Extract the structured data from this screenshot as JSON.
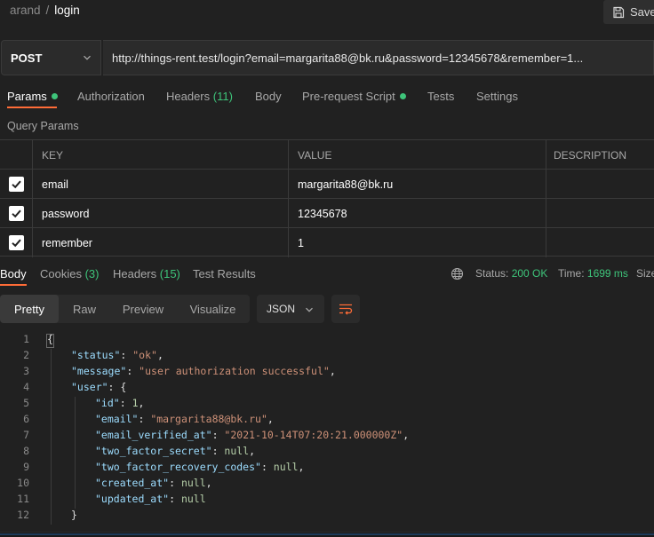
{
  "breadcrumb": {
    "parent": "arand",
    "separator": "/",
    "current": "login"
  },
  "save_label": "Save",
  "request": {
    "method": "POST",
    "url": "http://things-rent.test/login?email=margarita88@bk.ru&password=12345678&remember=1..."
  },
  "request_tabs": [
    {
      "label": "Params",
      "count": "",
      "dot": true,
      "active": true
    },
    {
      "label": "Authorization",
      "count": "",
      "dot": false
    },
    {
      "label": "Headers",
      "count": "(11)",
      "dot": false
    },
    {
      "label": "Body",
      "count": "",
      "dot": false
    },
    {
      "label": "Pre-request Script",
      "count": "",
      "dot": true
    },
    {
      "label": "Tests",
      "count": "",
      "dot": false
    },
    {
      "label": "Settings",
      "count": "",
      "dot": false
    }
  ],
  "query_params_title": "Query Params",
  "params_table": {
    "headers": {
      "key": "KEY",
      "value": "VALUE",
      "description": "DESCRIPTION"
    },
    "rows": [
      {
        "checked": true,
        "key": "email",
        "value": "margarita88@bk.ru",
        "description": ""
      },
      {
        "checked": true,
        "key": "password",
        "value": "12345678",
        "description": ""
      },
      {
        "checked": true,
        "key": "remember",
        "value": "1",
        "description": ""
      }
    ]
  },
  "response_tabs": [
    {
      "label": "Body",
      "count": "",
      "active": true
    },
    {
      "label": "Cookies",
      "count": "(3)"
    },
    {
      "label": "Headers",
      "count": "(15)"
    },
    {
      "label": "Test Results",
      "count": ""
    }
  ],
  "response_meta": {
    "status_label": "Status:",
    "status_value": "200 OK",
    "time_label": "Time:",
    "time_value": "1699 ms",
    "size_label": "Size"
  },
  "view_modes": [
    "Pretty",
    "Raw",
    "Preview",
    "Visualize"
  ],
  "active_view": "Pretty",
  "format": "JSON",
  "code_lines": [
    {
      "n": "1",
      "indent": 0,
      "tokens": [
        [
          "p",
          "{"
        ]
      ]
    },
    {
      "n": "2",
      "indent": 1,
      "tokens": [
        [
          "k",
          "\"status\""
        ],
        [
          "p",
          ": "
        ],
        [
          "s",
          "\"ok\""
        ],
        [
          "p",
          ","
        ]
      ]
    },
    {
      "n": "3",
      "indent": 1,
      "tokens": [
        [
          "k",
          "\"message\""
        ],
        [
          "p",
          ": "
        ],
        [
          "s",
          "\"user authorization successful\""
        ],
        [
          "p",
          ","
        ]
      ]
    },
    {
      "n": "4",
      "indent": 1,
      "tokens": [
        [
          "k",
          "\"user\""
        ],
        [
          "p",
          ": {"
        ]
      ]
    },
    {
      "n": "5",
      "indent": 2,
      "tokens": [
        [
          "k",
          "\"id\""
        ],
        [
          "p",
          ": "
        ],
        [
          "n",
          "1"
        ],
        [
          "p",
          ","
        ]
      ]
    },
    {
      "n": "6",
      "indent": 2,
      "tokens": [
        [
          "k",
          "\"email\""
        ],
        [
          "p",
          ": "
        ],
        [
          "s",
          "\"margarita88@bk.ru\""
        ],
        [
          "p",
          ","
        ]
      ]
    },
    {
      "n": "7",
      "indent": 2,
      "tokens": [
        [
          "k",
          "\"email_verified_at\""
        ],
        [
          "p",
          ": "
        ],
        [
          "s",
          "\"2021-10-14T07:20:21.000000Z\""
        ],
        [
          "p",
          ","
        ]
      ]
    },
    {
      "n": "8",
      "indent": 2,
      "tokens": [
        [
          "k",
          "\"two_factor_secret\""
        ],
        [
          "p",
          ": "
        ],
        [
          "n",
          "null"
        ],
        [
          "p",
          ","
        ]
      ]
    },
    {
      "n": "9",
      "indent": 2,
      "tokens": [
        [
          "k",
          "\"two_factor_recovery_codes\""
        ],
        [
          "p",
          ": "
        ],
        [
          "n",
          "null"
        ],
        [
          "p",
          ","
        ]
      ]
    },
    {
      "n": "10",
      "indent": 2,
      "tokens": [
        [
          "k",
          "\"created_at\""
        ],
        [
          "p",
          ": "
        ],
        [
          "n",
          "null"
        ],
        [
          "p",
          ","
        ]
      ]
    },
    {
      "n": "11",
      "indent": 2,
      "tokens": [
        [
          "k",
          "\"updated_at\""
        ],
        [
          "p",
          ": "
        ],
        [
          "n",
          "null"
        ]
      ]
    },
    {
      "n": "12",
      "indent": 1,
      "tokens": [
        [
          "p",
          "}"
        ]
      ]
    }
  ],
  "colors": {
    "accent": "#ff6c37",
    "success": "#3ec47a",
    "json_key": "#9cdcfe",
    "json_string": "#ce9178",
    "json_literal": "#b5cea8"
  },
  "icons": {
    "save": "save-icon",
    "method_dropdown": "chevron-down-icon",
    "globe": "globe-icon",
    "wrap": "wrap-lines-icon",
    "checkbox": "checkbox-checked-icon"
  }
}
